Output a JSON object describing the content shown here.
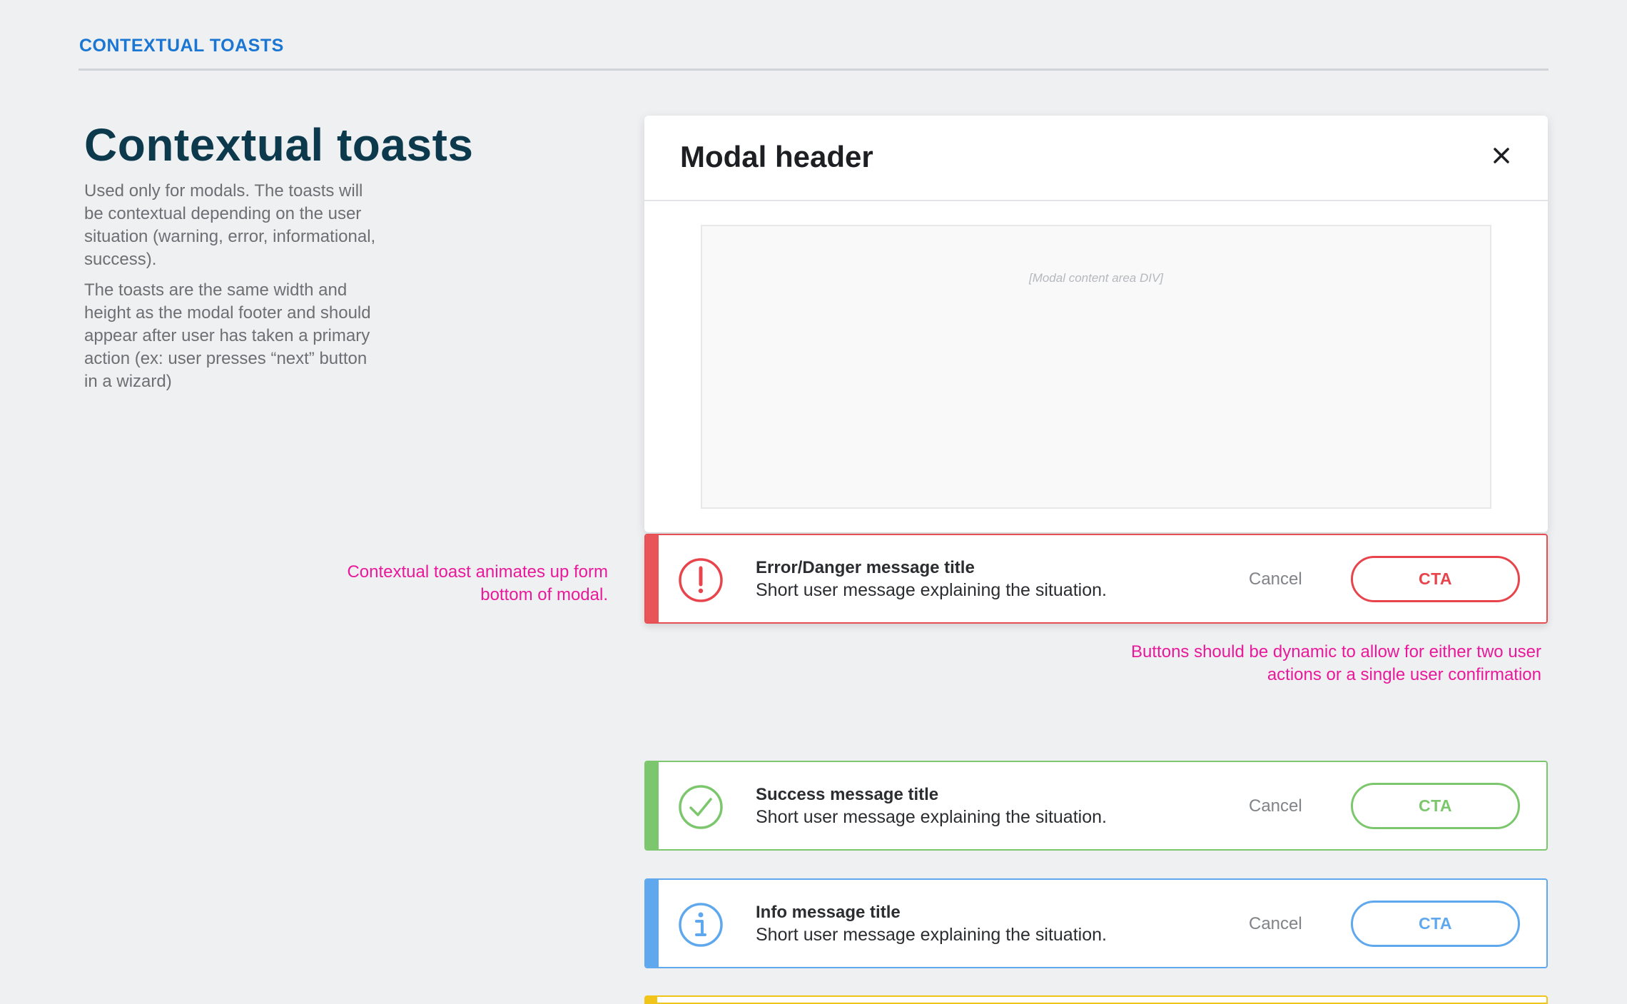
{
  "section_label": "CONTEXTUAL TOASTS",
  "page_title": "Contextual toasts",
  "description": [
    "Used only for modals. The toasts will be contextual depending on the user situation (warning, error, informational, success).",
    "The toasts are the same width and height as the modal footer and should appear after user has taken a primary action (ex: user presses “next” button in a wizard)"
  ],
  "annotations": {
    "toast_animation": "Contextual toast animates up form bottom of modal.",
    "dynamic_buttons": "Buttons should be dynamic to allow for either two user actions or a single user confirmation"
  },
  "modal": {
    "title": "Modal header",
    "close_icon": "close-icon",
    "content_placeholder": "[Modal content area  DIV]"
  },
  "toasts": [
    {
      "type": "error",
      "icon": "exclamation-circle-icon",
      "color": "#e8444c",
      "title": "Error/Danger message title",
      "message": "Short user message explaining the situation.",
      "cancel_label": "Cancel",
      "cta_label": "CTA"
    },
    {
      "type": "success",
      "icon": "check-circle-icon",
      "color": "#7cc76d",
      "title": "Success message title",
      "message": "Short user message explaining the situation.",
      "cancel_label": "Cancel",
      "cta_label": "CTA"
    },
    {
      "type": "info",
      "icon": "info-circle-icon",
      "color": "#5fa8ee",
      "title": "Info message title",
      "message": "Short user message explaining the situation.",
      "cancel_label": "Cancel",
      "cta_label": "CTA"
    },
    {
      "type": "warning",
      "color": "#f0c419"
    }
  ]
}
